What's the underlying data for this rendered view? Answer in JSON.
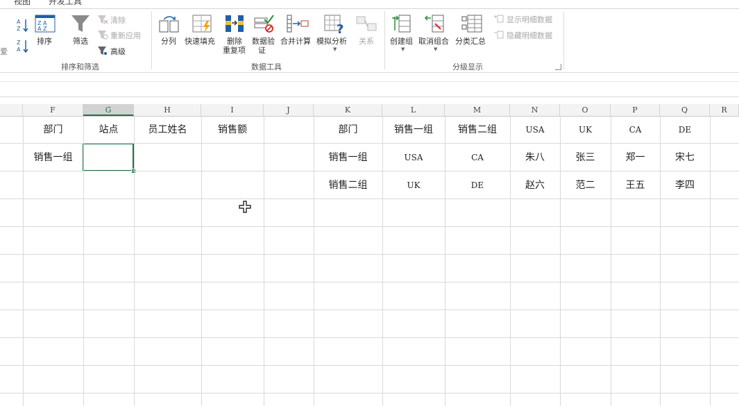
{
  "ribbon": {
    "tabs": [
      "视图",
      "开发工具"
    ],
    "sort_filter": {
      "label": "排序和筛选",
      "sort": "排序",
      "filter": "筛选",
      "clear": "清除",
      "reapply": "重新应用",
      "advanced": "高级"
    },
    "data_tools": {
      "label": "数据工具",
      "text_to_columns": "分列",
      "flash_fill": "快速填充",
      "remove_dup_1": "删除",
      "remove_dup_2": "重复项",
      "validation_1": "数据验",
      "validation_2": "证",
      "consolidate": "合并计算",
      "what_if": "模拟分析",
      "relationships": "关系"
    },
    "outline": {
      "label": "分级显示",
      "group": "创建组",
      "ungroup": "取消组合",
      "subtotal": "分类汇总",
      "show_detail": "显示明细数据",
      "hide_detail": "隐藏明细数据"
    }
  },
  "columns": [
    "F",
    "G",
    "H",
    "I",
    "J",
    "K",
    "L",
    "M",
    "N",
    "O",
    "P",
    "Q",
    "R"
  ],
  "selected_column": "G",
  "rows": [
    {
      "F": "部门",
      "G": "站点",
      "H": "员工姓名",
      "I": "销售额",
      "K": "部门",
      "L": "销售一组",
      "M": "销售二组",
      "N": "USA",
      "O": "UK",
      "P": "CA",
      "Q": "DE"
    },
    {
      "F": "销售一组",
      "G": "",
      "K": "销售一组",
      "L": "USA",
      "M": "CA",
      "N": "朱八",
      "O": "张三",
      "P": "郑一",
      "Q": "宋七"
    },
    {
      "K": "销售二组",
      "L": "UK",
      "M": "DE",
      "N": "赵六",
      "O": "范二",
      "P": "王五",
      "Q": "李四"
    }
  ],
  "colors": {
    "accent": "#217346",
    "gridline": "#d9d9d9"
  }
}
